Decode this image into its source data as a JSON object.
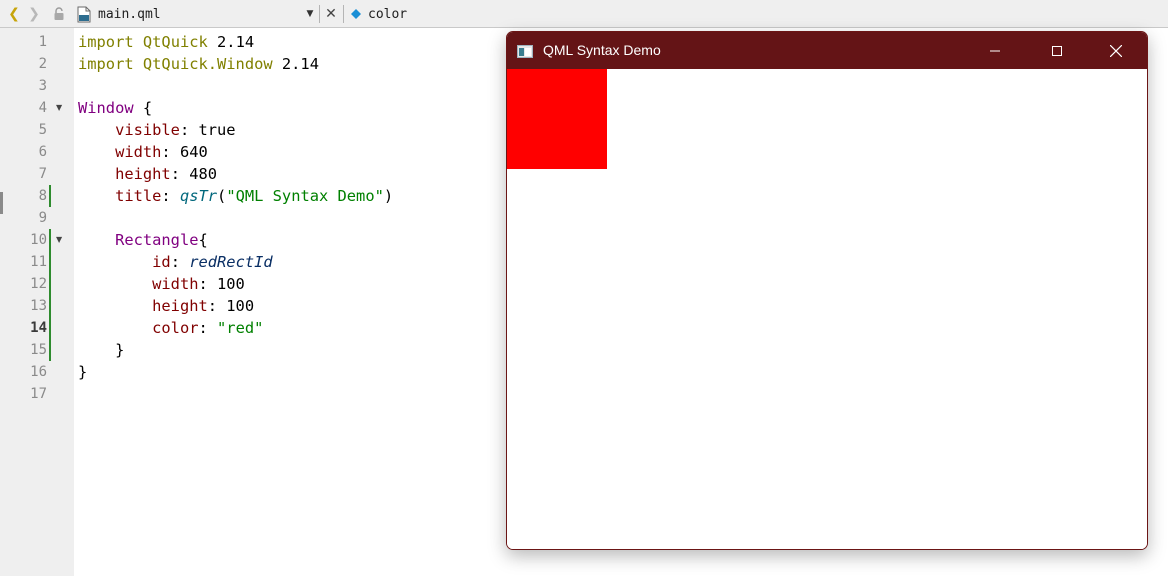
{
  "toolbar": {
    "back_icon": "chevron-left-icon",
    "forward_icon": "chevron-right-icon",
    "lock_icon": "lock-icon",
    "file_icon": "qml-file-icon",
    "file_name": "main.qml",
    "dropdown_icon": "triangle-down-icon",
    "close_icon": "close-icon",
    "symbol_icon": "diamond-icon",
    "symbol_name": "color"
  },
  "editor": {
    "current_line": 14,
    "lines": [
      {
        "n": "1",
        "text": "import QtQuick 2.14"
      },
      {
        "n": "2",
        "text": "import QtQuick.Window 2.14"
      },
      {
        "n": "3",
        "text": ""
      },
      {
        "n": "4",
        "text": "Window {"
      },
      {
        "n": "5",
        "text": "    visible: true"
      },
      {
        "n": "6",
        "text": "    width: 640"
      },
      {
        "n": "7",
        "text": "    height: 480"
      },
      {
        "n": "8",
        "text": "    title: qsTr(\"QML Syntax Demo\")"
      },
      {
        "n": "9",
        "text": ""
      },
      {
        "n": "10",
        "text": "    Rectangle{"
      },
      {
        "n": "11",
        "text": "        id: redRectId"
      },
      {
        "n": "12",
        "text": "        width: 100"
      },
      {
        "n": "13",
        "text": "        height: 100"
      },
      {
        "n": "14",
        "text": "        color: \"red\""
      },
      {
        "n": "15",
        "text": "    }"
      },
      {
        "n": "16",
        "text": "}"
      },
      {
        "n": "17",
        "text": ""
      }
    ]
  },
  "preview": {
    "title": "QML Syntax Demo",
    "titlebar_color": "#641416",
    "rect_color": "#ff0000",
    "minimize_icon": "minimize-icon",
    "maximize_icon": "maximize-icon",
    "close_icon": "close-icon"
  }
}
